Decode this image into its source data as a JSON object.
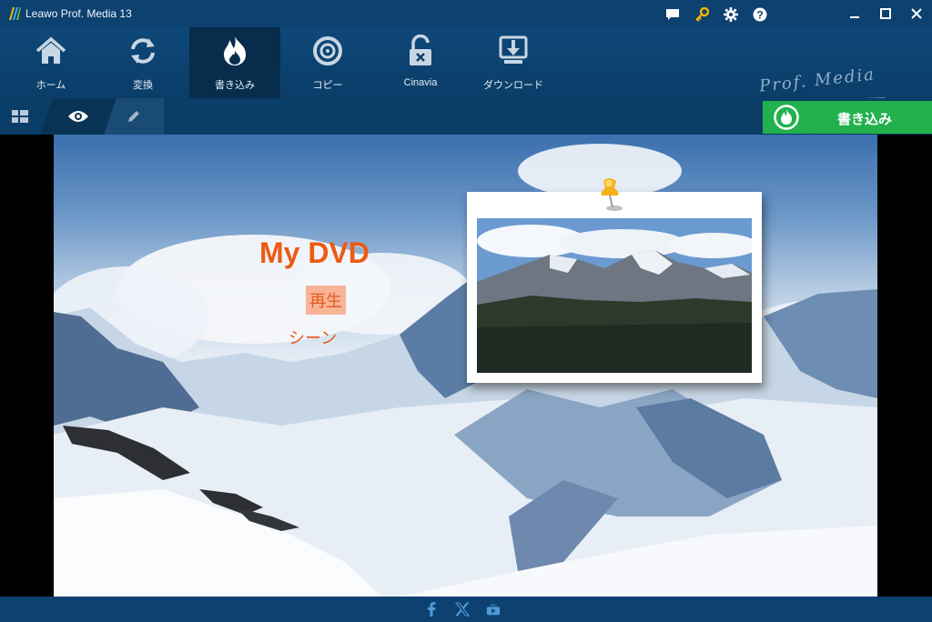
{
  "app": {
    "title": "Leawo Prof. Media 13"
  },
  "titlebar": {
    "icons": [
      "feedback-icon",
      "key-icon",
      "gear-icon",
      "help-icon"
    ],
    "controls": [
      "minimize-icon",
      "maximize-icon",
      "close-icon"
    ]
  },
  "nav": {
    "items": [
      {
        "label": "ホーム",
        "icon": "home-icon",
        "active": false
      },
      {
        "label": "変換",
        "icon": "convert-icon",
        "active": false
      },
      {
        "label": "書き込み",
        "icon": "burn-icon",
        "active": true
      },
      {
        "label": "コピー",
        "icon": "copy-disc-icon",
        "active": false
      },
      {
        "label": "Cinavia",
        "icon": "cinavia-unlock-icon",
        "active": false
      },
      {
        "label": "ダウンロード",
        "icon": "download-icon",
        "active": false
      }
    ]
  },
  "brand": {
    "text": "Prof. Media"
  },
  "toolbar": {
    "modes": [
      "grid-view-icon",
      "preview-eye-icon",
      "edit-pencil-icon"
    ],
    "active_mode": "preview",
    "burn_label": "書き込み"
  },
  "menu_preview": {
    "title": "My DVD",
    "play": "再生",
    "scene": "シーン"
  },
  "footer": {
    "social": [
      "facebook-icon",
      "x-icon",
      "youtube-icon"
    ]
  },
  "colors": {
    "accent_green": "#22b14c",
    "title_orange": "#ec5a14",
    "nav_bg": "#0b3d68",
    "nav_active": "#072c4c"
  }
}
